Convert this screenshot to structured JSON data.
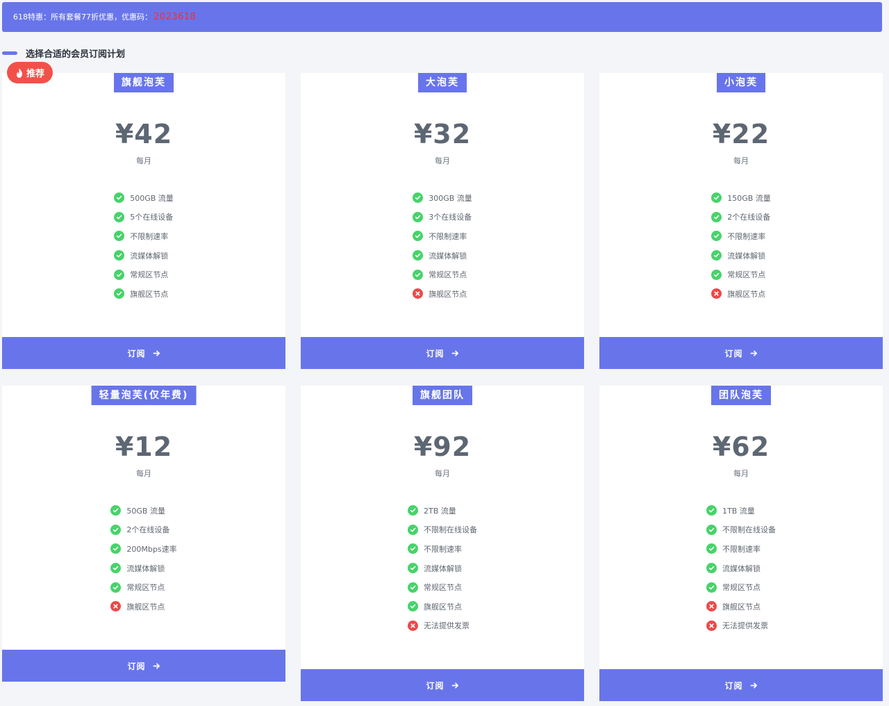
{
  "banner": {
    "text": "618特惠：所有套餐77折优惠，优惠码：",
    "code": "2023618",
    "code_color": "#ff2a2a"
  },
  "section": {
    "title": "选择合适的会员订阅计划"
  },
  "badge": {
    "label": "推荐",
    "icon": "fire-icon"
  },
  "subscribe_label": "订阅",
  "colors": {
    "accent": "#6875ea",
    "check": "#47d36a",
    "cross": "#ea4a4a",
    "badge": "#f2514a"
  },
  "plans": [
    {
      "name": "旗舰泡芙",
      "price": "¥42",
      "period": "每月",
      "features": [
        {
          "text": "500GB 流量",
          "ok": true
        },
        {
          "text": "5个在线设备",
          "ok": true
        },
        {
          "text": "不限制速率",
          "ok": true
        },
        {
          "text": "流媒体解锁",
          "ok": true
        },
        {
          "text": "常规区节点",
          "ok": true
        },
        {
          "text": "旗舰区节点",
          "ok": true
        }
      ]
    },
    {
      "name": "大泡芙",
      "price": "¥32",
      "period": "每月",
      "features": [
        {
          "text": "300GB 流量",
          "ok": true
        },
        {
          "text": "3个在线设备",
          "ok": true
        },
        {
          "text": "不限制速率",
          "ok": true
        },
        {
          "text": "流媒体解锁",
          "ok": true
        },
        {
          "text": "常规区节点",
          "ok": true
        },
        {
          "text": "旗舰区节点",
          "ok": false
        }
      ]
    },
    {
      "name": "小泡芙",
      "price": "¥22",
      "period": "每月",
      "features": [
        {
          "text": "150GB 流量",
          "ok": true
        },
        {
          "text": "2个在线设备",
          "ok": true
        },
        {
          "text": "不限制速率",
          "ok": true
        },
        {
          "text": "流媒体解锁",
          "ok": true
        },
        {
          "text": "常规区节点",
          "ok": true
        },
        {
          "text": "旗舰区节点",
          "ok": false
        }
      ]
    },
    {
      "name": "轻量泡芙(仅年费)",
      "price": "¥12",
      "period": "每月",
      "features": [
        {
          "text": "50GB 流量",
          "ok": true
        },
        {
          "text": "2个在线设备",
          "ok": true
        },
        {
          "text": "200Mbps速率",
          "ok": true
        },
        {
          "text": "流媒体解锁",
          "ok": true
        },
        {
          "text": "常规区节点",
          "ok": true
        },
        {
          "text": "旗舰区节点",
          "ok": false
        }
      ]
    },
    {
      "name": "旗舰团队",
      "price": "¥92",
      "period": "每月",
      "features": [
        {
          "text": "2TB 流量",
          "ok": true
        },
        {
          "text": "不限制在线设备",
          "ok": true
        },
        {
          "text": "不限制速率",
          "ok": true
        },
        {
          "text": "流媒体解锁",
          "ok": true
        },
        {
          "text": "常规区节点",
          "ok": true
        },
        {
          "text": "旗舰区节点",
          "ok": true
        },
        {
          "text": "无法提供发票",
          "ok": false
        }
      ]
    },
    {
      "name": "团队泡芙",
      "price": "¥62",
      "period": "每月",
      "features": [
        {
          "text": "1TB 流量",
          "ok": true
        },
        {
          "text": "不限制在线设备",
          "ok": true
        },
        {
          "text": "不限制速率",
          "ok": true
        },
        {
          "text": "流媒体解锁",
          "ok": true
        },
        {
          "text": "常规区节点",
          "ok": true
        },
        {
          "text": "旗舰区节点",
          "ok": false
        },
        {
          "text": "无法提供发票",
          "ok": false
        }
      ]
    }
  ]
}
